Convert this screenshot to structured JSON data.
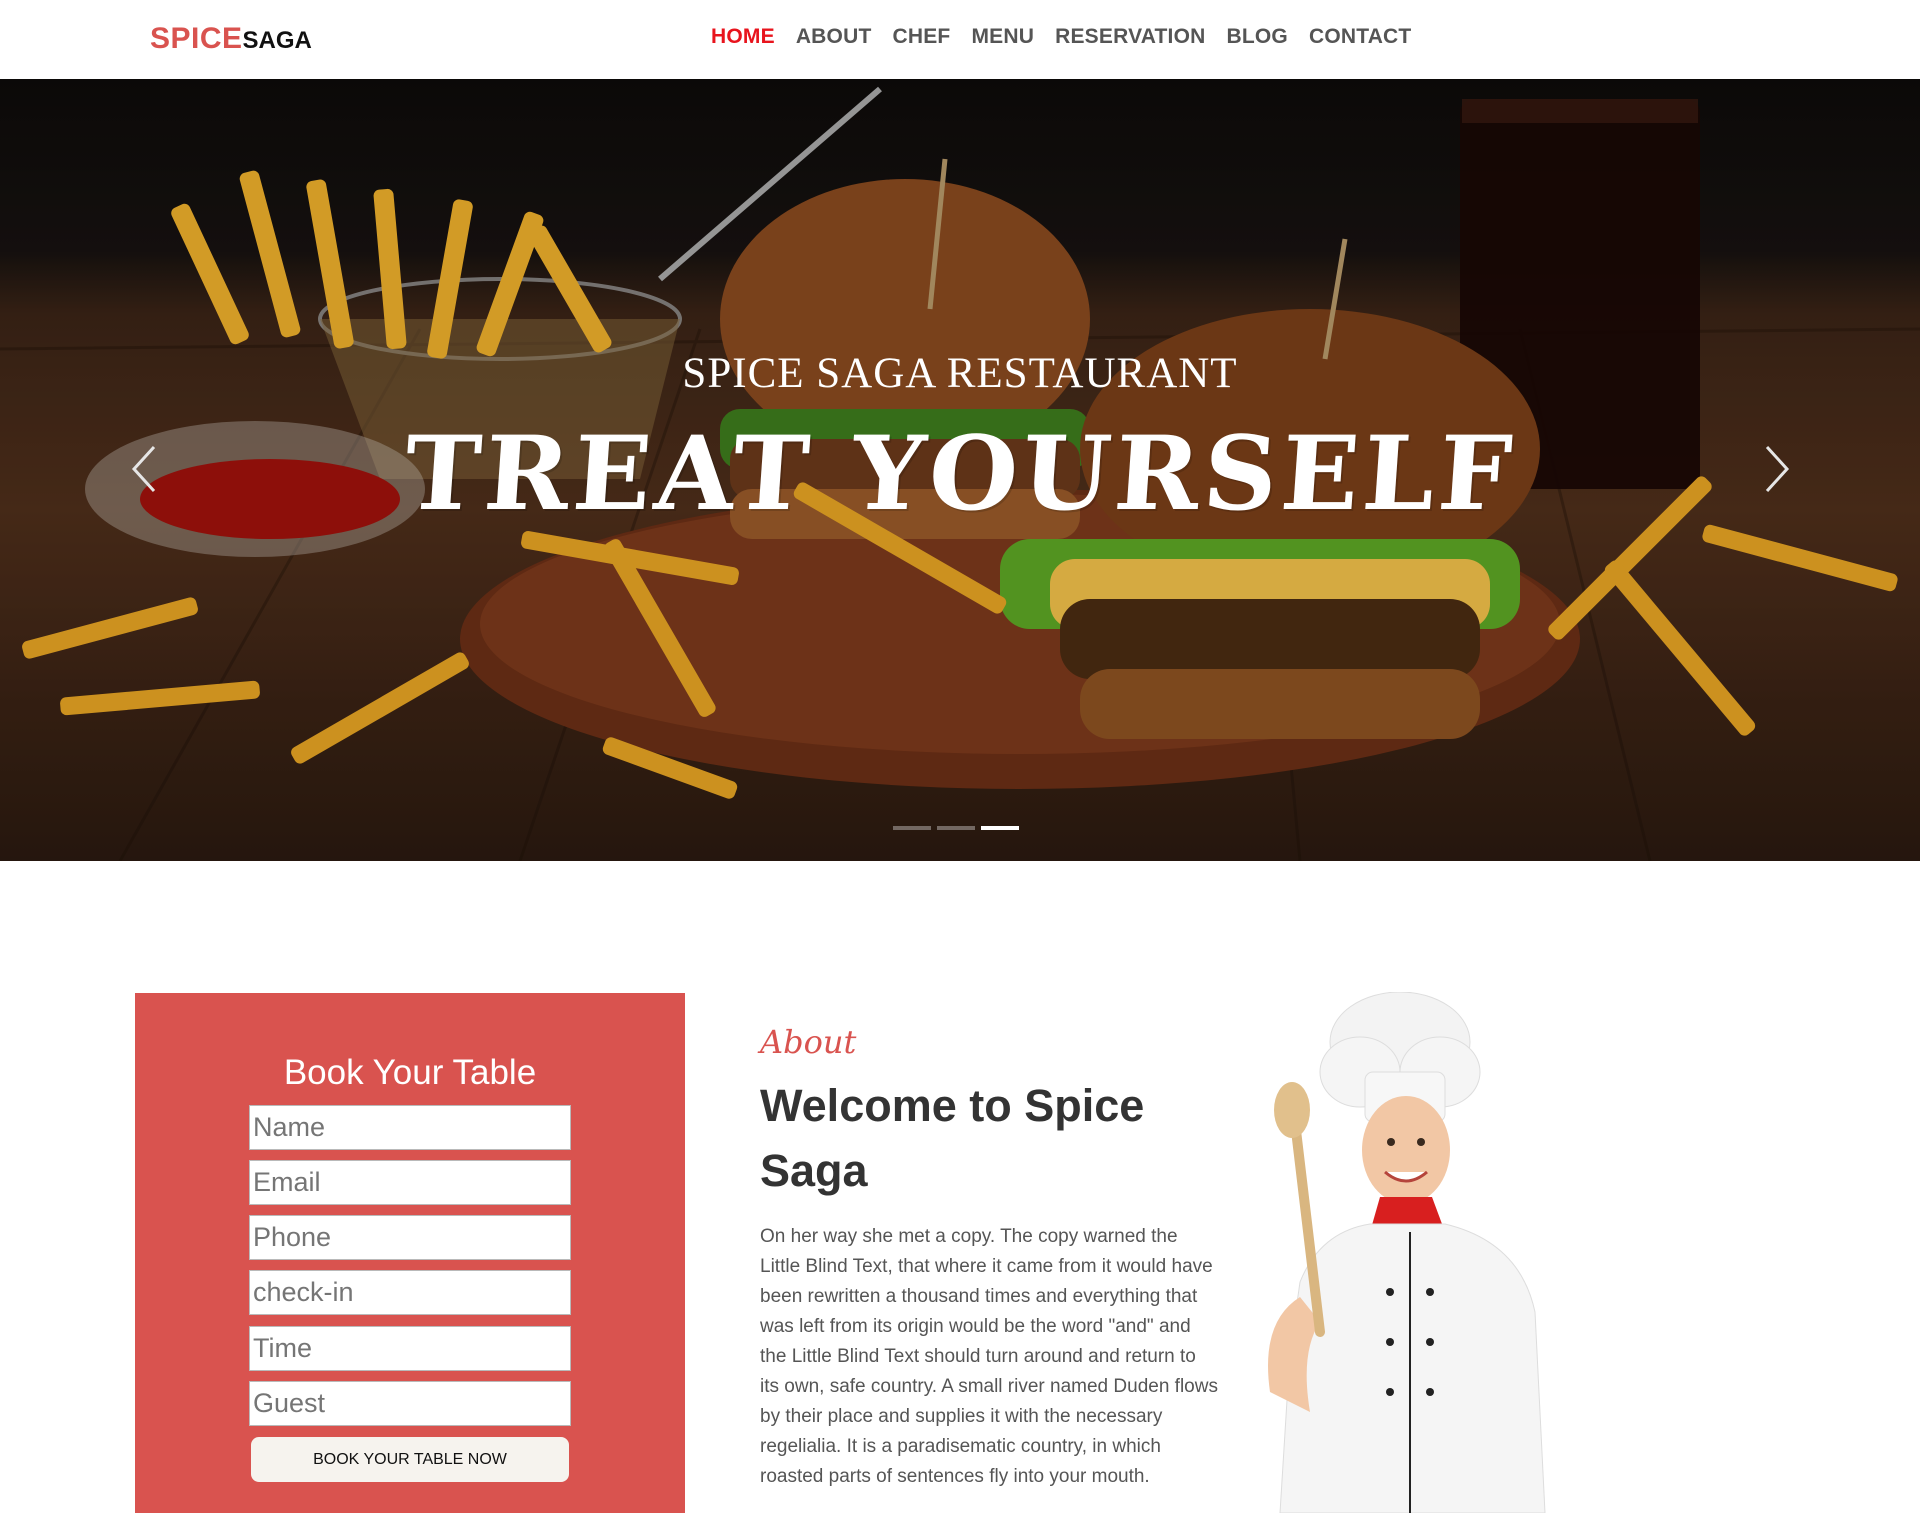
{
  "brand": {
    "part1": "SPICE",
    "part2": "SAGA"
  },
  "nav": {
    "items": [
      {
        "label": "HOME"
      },
      {
        "label": "ABOUT"
      },
      {
        "label": "CHEF"
      },
      {
        "label": "MENU"
      },
      {
        "label": "RESERVATION"
      },
      {
        "label": "BLOG"
      },
      {
        "label": "CONTACT"
      }
    ],
    "active_index": 0
  },
  "hero": {
    "subtitle": "SPICE SAGA RESTAURANT",
    "title": "TREAT YOURSELF",
    "prev_icon": "chevron-left-icon",
    "next_icon": "chevron-right-icon",
    "slide_count": 3,
    "active_slide": 3
  },
  "booking": {
    "title": "Book Your Table",
    "fields": {
      "name": {
        "placeholder": "Name"
      },
      "email": {
        "placeholder": "Email"
      },
      "phone": {
        "placeholder": "Phone"
      },
      "checkin": {
        "placeholder": "check-in"
      },
      "time": {
        "placeholder": "Time"
      },
      "guest": {
        "placeholder": "Guest"
      }
    },
    "button_label": "BOOK YOUR TABLE NOW"
  },
  "about": {
    "label": "About",
    "title": "Welcome to Spice Saga",
    "text": "On her way she met a copy. The copy warned the Little Blind Text, that where it came from it would have been rewritten a thousand times and everything that was left from its origin would be the word \"and\" and the Little Blind Text should turn around and return to its own, safe country. A small river named Duden flows by their place and supplies it with the necessary regelialia. It is a paradisematic country, in which roasted parts of sentences fly into your mouth."
  },
  "colors": {
    "accent": "#d9534f",
    "nav_active": "#e8141d",
    "nav_text": "#555555"
  }
}
